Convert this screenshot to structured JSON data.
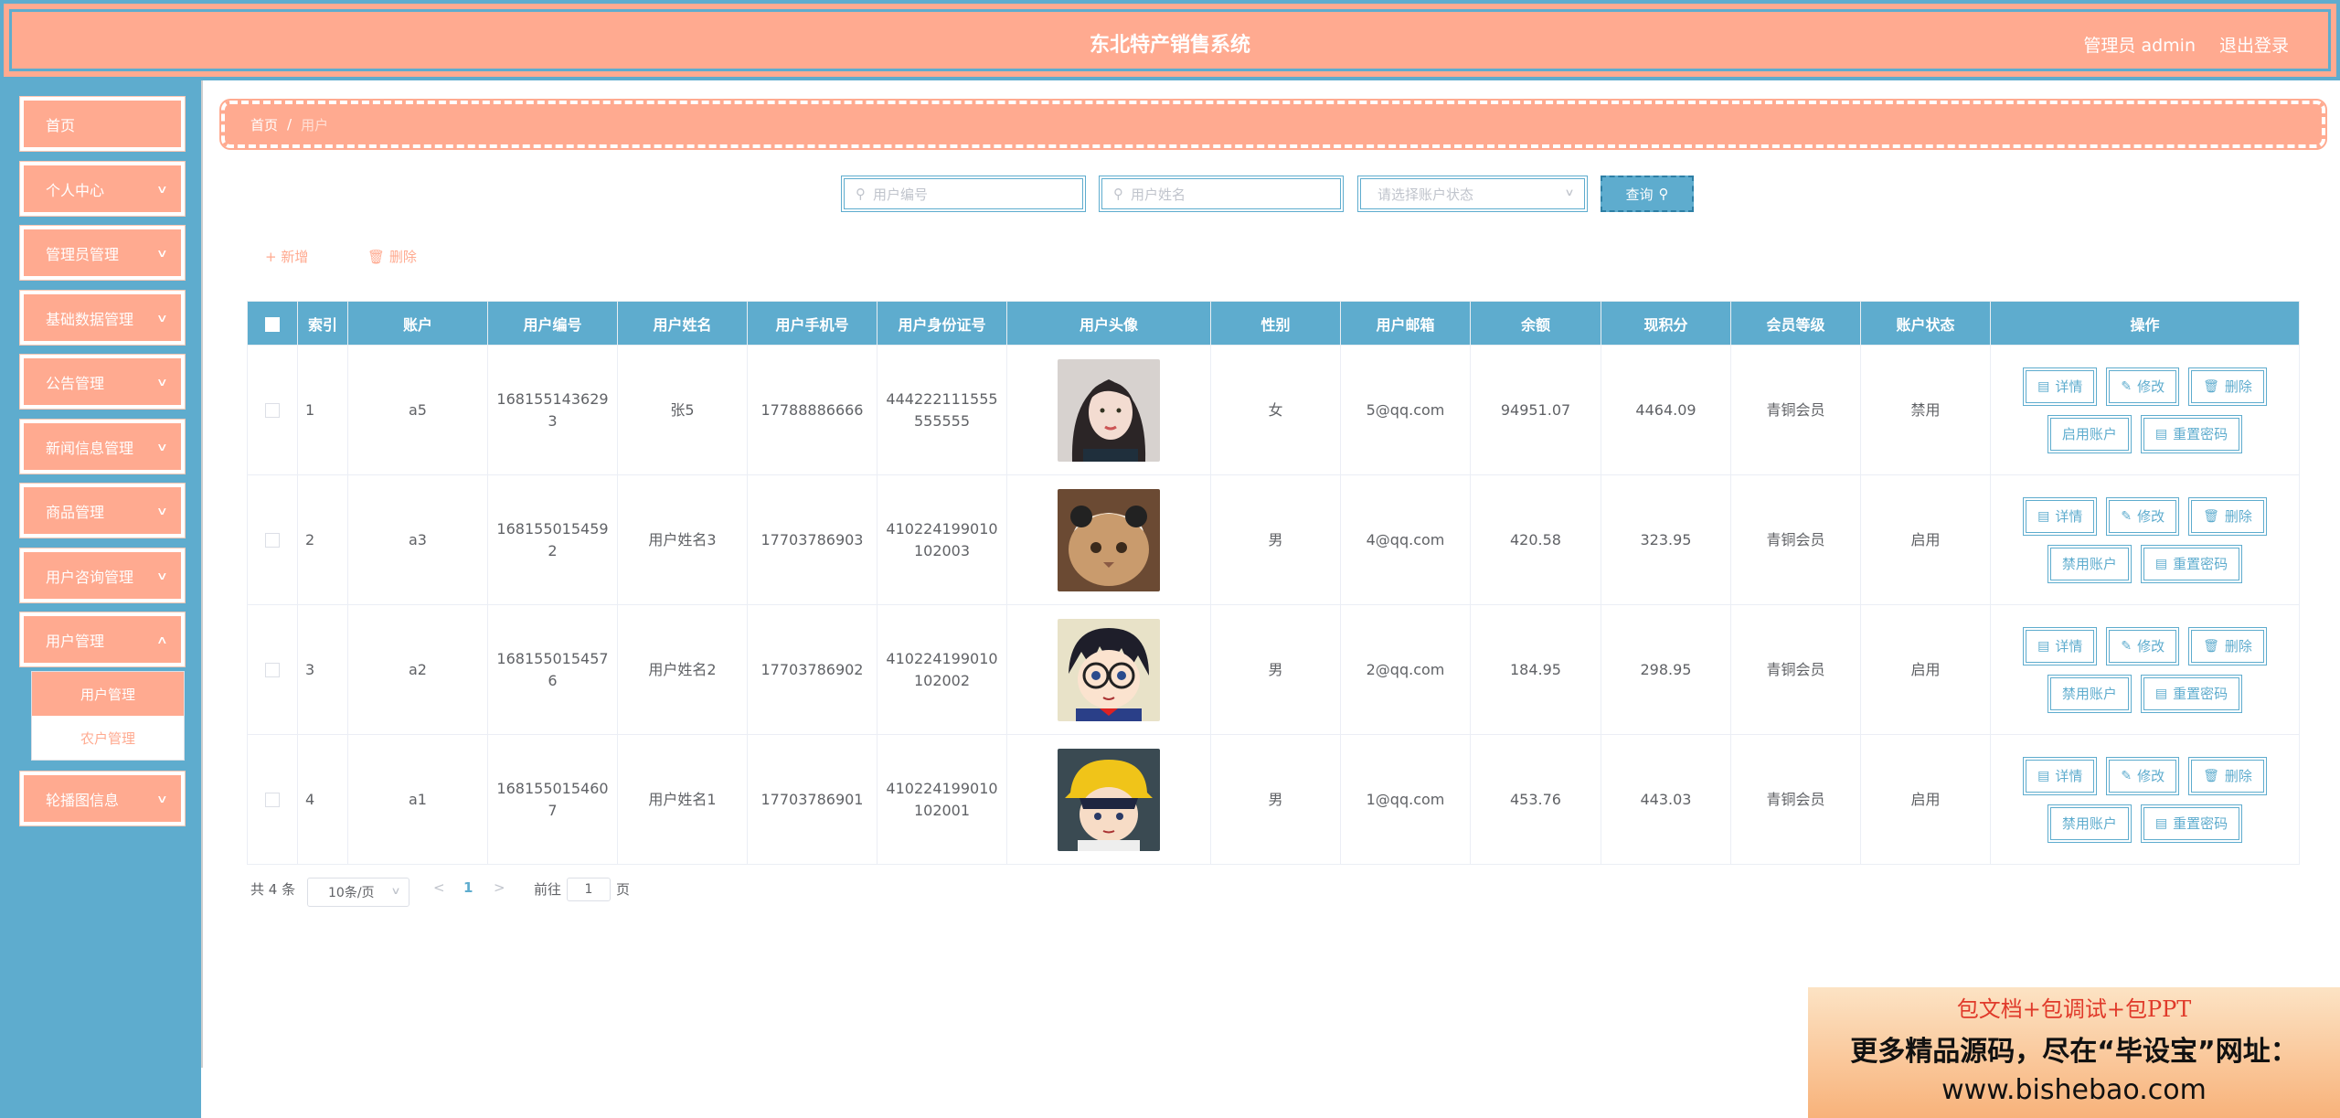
{
  "header": {
    "title": "东北特产销售系统",
    "user": "管理员 admin",
    "logout": "退出登录"
  },
  "sidebar": {
    "items": [
      {
        "label": "首页"
      },
      {
        "label": "个人中心"
      },
      {
        "label": "管理员管理"
      },
      {
        "label": "基础数据管理"
      },
      {
        "label": "公告管理"
      },
      {
        "label": "新闻信息管理"
      },
      {
        "label": "商品管理"
      },
      {
        "label": "用户咨询管理"
      },
      {
        "label": "用户管理"
      },
      {
        "label": "轮播图信息"
      }
    ],
    "submenu": [
      "用户管理",
      "农户管理"
    ]
  },
  "breadcrumb": {
    "home": "首页",
    "sep": "/",
    "current": "用户"
  },
  "search": {
    "code_placeholder": "用户编号",
    "name_placeholder": "用户姓名",
    "status_placeholder": "请选择账户状态",
    "button": "查询"
  },
  "actions": {
    "add": "新增",
    "delete": "删除"
  },
  "table": {
    "headers": [
      "",
      "索引",
      "账户",
      "用户编号",
      "用户姓名",
      "用户手机号",
      "用户身份证号",
      "用户头像",
      "性别",
      "用户邮箱",
      "余额",
      "现积分",
      "会员等级",
      "账户状态",
      "操作"
    ],
    "rows": [
      {
        "index": "1",
        "account": "a5",
        "code": "1681551436293",
        "name": "张5",
        "phone": "17788886666",
        "idcard": "444222111555555555",
        "gender": "女",
        "email": "5@qq.com",
        "balance": "94951.07",
        "points": "4464.09",
        "level": "青铜会员",
        "status": "禁用",
        "toggle": "启用账户"
      },
      {
        "index": "2",
        "account": "a3",
        "code": "1681550154592",
        "name": "用户姓名3",
        "phone": "17703786903",
        "idcard": "410224199010102003",
        "gender": "男",
        "email": "4@qq.com",
        "balance": "420.58",
        "points": "323.95",
        "level": "青铜会员",
        "status": "启用",
        "toggle": "禁用账户"
      },
      {
        "index": "3",
        "account": "a2",
        "code": "1681550154576",
        "name": "用户姓名2",
        "phone": "17703786902",
        "idcard": "410224199010102002",
        "gender": "男",
        "email": "2@qq.com",
        "balance": "184.95",
        "points": "298.95",
        "level": "青铜会员",
        "status": "启用",
        "toggle": "禁用账户"
      },
      {
        "index": "4",
        "account": "a1",
        "code": "1681550154607",
        "name": "用户姓名1",
        "phone": "17703786901",
        "idcard": "410224199010102001",
        "gender": "男",
        "email": "1@qq.com",
        "balance": "453.76",
        "points": "443.03",
        "level": "青铜会员",
        "status": "启用",
        "toggle": "禁用账户"
      }
    ],
    "op_labels": {
      "detail": "详情",
      "edit": "修改",
      "delete": "删除",
      "reset": "重置密码"
    }
  },
  "pagination": {
    "total": "共 4 条",
    "page_size": "10条/页",
    "current": "1",
    "goto_label": "前往",
    "goto_value": "1",
    "goto_suffix": "页"
  },
  "watermark": {
    "line1": "包文档+包调试+包PPT",
    "line2": "更多精品源码，尽在“毕设宝”网址：",
    "line3": "www.bishebao.com"
  },
  "colors": {
    "primary": "#5eacce",
    "accent": "#ffaa90"
  }
}
